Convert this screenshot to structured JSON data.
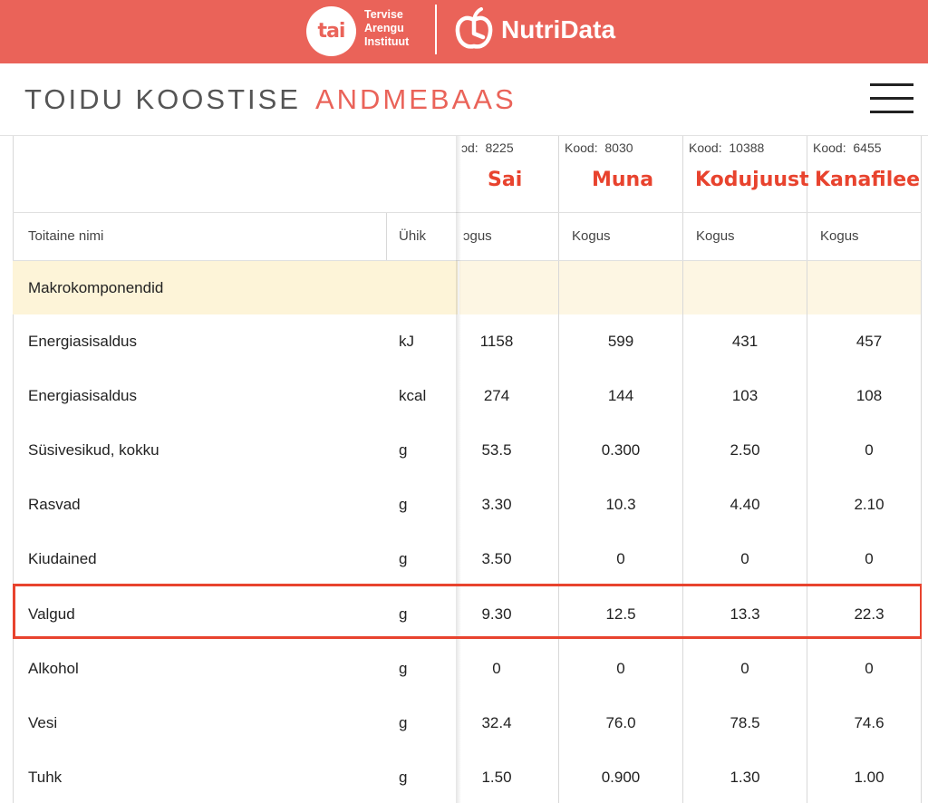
{
  "brand": {
    "logo_text": "tai",
    "org_lines": [
      "Tervise",
      "Arengu",
      "Instituut"
    ],
    "app_name": "NutriData",
    "colors": {
      "bar": "#ea6359",
      "accent": "#e8432e"
    }
  },
  "header": {
    "title_part1": "TOIDU KOOSTISE",
    "title_part2": "ANDMEBAAS",
    "menu_icon": "hamburger-menu-icon"
  },
  "table": {
    "foods": [
      {
        "code_label": "ɔd:",
        "code": "8225",
        "name": "Sai",
        "qty_label": "ɔgus"
      },
      {
        "code_label": "Kood:",
        "code": "8030",
        "name": "Muna",
        "qty_label": "Kogus"
      },
      {
        "code_label": "Kood:",
        "code": "10388",
        "name": "Kodujuust",
        "qty_label": "Kogus"
      },
      {
        "code_label": "Kood:",
        "code": "6455",
        "name": "Kanafilee",
        "qty_label": "Kogus"
      }
    ],
    "col_nutrient": "Toitaine nimi",
    "col_unit": "Ühik",
    "section": "Makrokomponendid",
    "rows": [
      {
        "name": "Energiasisaldus",
        "unit": "kJ",
        "values": [
          "1158",
          "599",
          "431",
          "457"
        ]
      },
      {
        "name": "Energiasisaldus",
        "unit": "kcal",
        "values": [
          "274",
          "144",
          "103",
          "108"
        ]
      },
      {
        "name": "Süsivesikud, kokku",
        "unit": "g",
        "values": [
          "53.5",
          "0.300",
          "2.50",
          "0"
        ]
      },
      {
        "name": "Rasvad",
        "unit": "g",
        "values": [
          "3.30",
          "10.3",
          "4.40",
          "2.10"
        ]
      },
      {
        "name": "Kiudained",
        "unit": "g",
        "values": [
          "3.50",
          "0",
          "0",
          "0"
        ]
      },
      {
        "name": "Valgud",
        "unit": "g",
        "values": [
          "9.30",
          "12.5",
          "13.3",
          "22.3"
        ]
      },
      {
        "name": "Alkohol",
        "unit": "g",
        "values": [
          "0",
          "0",
          "0",
          "0"
        ]
      },
      {
        "name": "Vesi",
        "unit": "g",
        "values": [
          "32.4",
          "76.0",
          "78.5",
          "74.6"
        ]
      },
      {
        "name": "Tuhk",
        "unit": "g",
        "values": [
          "1.50",
          "0.900",
          "1.30",
          "1.00"
        ]
      }
    ]
  }
}
